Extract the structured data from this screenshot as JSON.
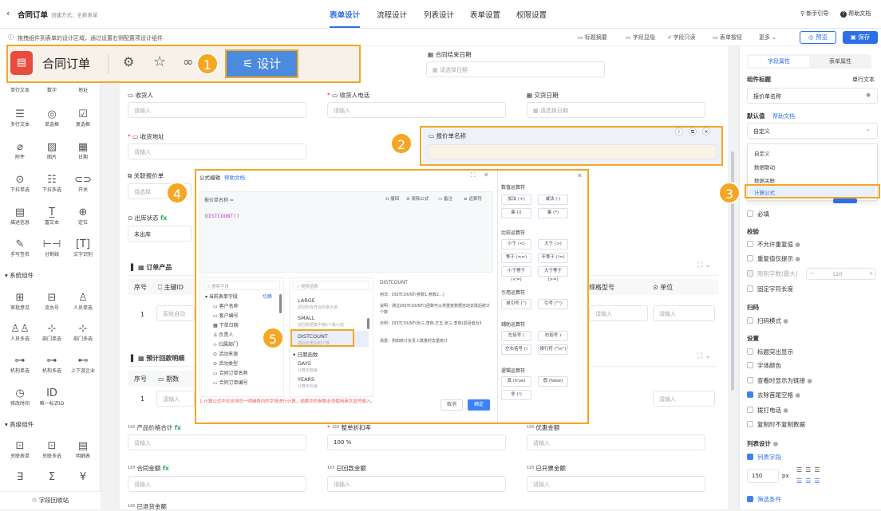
{
  "topbar": {
    "back_icon": "chevron-left-icon",
    "title": "合同订单",
    "created_by": "创建方式：全新表单",
    "tabs": [
      "表单设计",
      "流程设计",
      "列表设计",
      "表单设置",
      "权限设置"
    ],
    "active_tab": "表单设计",
    "guide": "新手引导",
    "help": "帮助文档"
  },
  "notice": {
    "text": "拖拽组件到表单的设计区域，通过设置右侧配置项设计组件",
    "tools": [
      "标题摘要",
      "字段显隐",
      "字段只读",
      "表单按钮",
      "更多"
    ],
    "preview": "预览",
    "save": "保存"
  },
  "overlay_header": {
    "title": "合同订单",
    "design_label": "设计"
  },
  "left_panel": {
    "row1": [
      "单行文本",
      "数字",
      "地址"
    ],
    "row2": [
      "多行文本",
      "单选框",
      "复选框"
    ],
    "row3": [
      "附件",
      "图片",
      "日期"
    ],
    "row4": [
      "下拉单选",
      "下拉多选",
      "开关"
    ],
    "row5": [
      "描述信息",
      "富文本",
      "定位"
    ],
    "row6": [
      "手写签名",
      "分割线",
      "文字识别"
    ],
    "system_title": "系统组件",
    "sys1": [
      "审批意见",
      "流水号",
      "人员单选"
    ],
    "sys2": [
      "人员多选",
      "部门单选",
      "部门多选"
    ],
    "sys3": [
      "机构单选",
      "机构多选",
      "上下游企业"
    ],
    "sys4": [
      "修改时间",
      "唯一标识ID"
    ],
    "advanced_title": "高级组件",
    "adv1": [
      "关联表单",
      "关联多选",
      "明细表"
    ],
    "recycle": "字段回收站"
  },
  "canvas": {
    "contract_end_date": "合同结束日期",
    "select_date": "请选择日期",
    "receiver": "收货人",
    "receiver_phone": "收货人电话",
    "delivery_date": "交货日期",
    "please_input": "请输入",
    "ship_address": "收货地址",
    "quote_name": "报价单名称",
    "related_quote": "关联报价单",
    "please_select": "请选择",
    "outbound_status": "出库状态",
    "fx": "fx",
    "not_outbound": "未出库",
    "order_products": "订单产品",
    "col_seq": "序号",
    "col_id": "主键ID",
    "col_spec": "规格型号",
    "col_unit": "单位",
    "row1": "1",
    "auto_num": "系统自动",
    "plan_title": "预计回款明细",
    "col_periods": "期数",
    "product_total": "产品价格合计",
    "discount": "整单折扣率",
    "discount_value": "100 %",
    "preferential": "优惠金额",
    "contract_amount": "合同金额",
    "received": "已回款金额",
    "invoiced": "已开票金额",
    "refunded": "已退货金额"
  },
  "formula": {
    "title": "公式编辑",
    "help": "帮助文档",
    "field_label": "报价单名称 =",
    "tools": [
      "撤回",
      "清除公式",
      "备注",
      "运算符"
    ],
    "expression": "DISTCOUNT()",
    "search_field": "搜索字段",
    "search_func": "搜索函数",
    "tree_root": "当前表单字段",
    "switch": "切换",
    "fields": [
      "客户名称",
      "客户编号",
      "下单日期",
      "负责人",
      "归属部门",
      "活动来源",
      "活动类型",
      "合同订单名称",
      "合同订单编号"
    ],
    "funcs": [
      "LARGE",
      "SMALL",
      "DISTCOUNT",
      "DAYS",
      "YEARS"
    ],
    "func_subs": [
      "返回所有符合的最大值",
      "返回数据集中第k个最小值",
      "返回去重后的个数",
      "计算天数差",
      "计算年份差"
    ],
    "date_group": "日期函数",
    "desc_title": "DISTCOUNT",
    "desc_lines": [
      "用法：DISTCOUNT(参数1,参数2...)",
      "说明：通过DISTCOUNT()函数可以将重复数据自动去除后统计个数",
      "示例：DISTCOUNT(张三,李四,王五,张三,李四)返回值为3",
      "场景：例如统计负责人数量时去重统计"
    ],
    "footer_note": "1.计算公式中仅支持同一明细表内的字段进行计算，函数中的参数必须使用英文逗号输入。",
    "cancel": "取消",
    "confirm": "确定"
  },
  "operators": {
    "math_title": "数值运算符",
    "math": [
      "加法 (+)",
      "减法 (-)",
      "乘 (/)",
      "乘 (*)"
    ],
    "compare_title": "比较运算符",
    "compare": [
      "小于 (<)",
      "大于 (>)",
      "等于 (==)",
      "不等于 (!=)",
      "小于等于 (<=)",
      "大于等于 (>=)"
    ],
    "quote_title": "引用运算符",
    "quote": [
      "单引号 ('')",
      "引号 (\"\")"
    ],
    "aux_title": "辅助运算符",
    "aux": [
      "左括号 (",
      "右括号 )",
      "左右括号 ()",
      "换行符 (\"\\n\")"
    ],
    "logic_title": "逻辑运算符",
    "logic": [
      "真 (true)",
      "假 (false)",
      "非 (!)"
    ]
  },
  "right_panel": {
    "tabs": [
      "字段属性",
      "表单属性"
    ],
    "field_title": "组件标题",
    "field_type": "单行文本",
    "title_value": "报价单名称",
    "default_label": "默认值",
    "help_doc": "帮助文档",
    "default_value": "自定义",
    "options": [
      "自定义",
      "数据联动",
      "数据关联",
      "计算公式"
    ],
    "required": "必填",
    "validate": "校验",
    "v_items": [
      "不允许重复值",
      "重复值仅提示",
      "限制字数(最大)",
      "固定字符长度"
    ],
    "max_chars": "120",
    "scan": "扫码",
    "scan_mode": "扫码模式",
    "settings": "设置",
    "s_items": [
      "标题突出显示",
      "字体颜色",
      "查看时显示为链接",
      "去除首尾空格",
      "拨打电话",
      "复制时不复制数据"
    ],
    "list_design": "列表设计",
    "list_field": "列表字段",
    "width": "150",
    "unit": "px",
    "filter": "筛选条件"
  },
  "badges": [
    "1",
    "2",
    "3",
    "4",
    "5"
  ],
  "colors": {
    "accent": "#3b82f6",
    "highlight": "#f5a623",
    "logo": "#e74c3c"
  }
}
